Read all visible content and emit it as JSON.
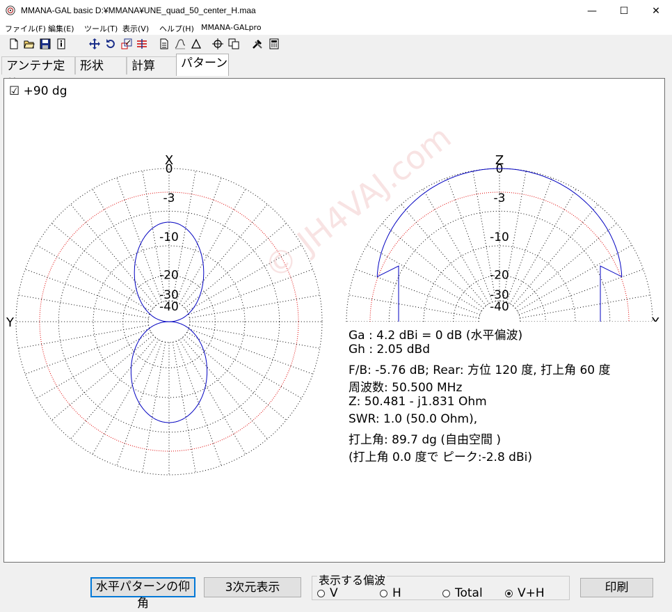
{
  "window": {
    "title": "MMANA-GAL basic  D:¥MMANA¥UNE_quad_50_center_H.maa",
    "minimize": "—",
    "maximize": "☐",
    "close": "✕"
  },
  "menu": [
    {
      "label": "ファイル(F)"
    },
    {
      "label": "編集(E)"
    },
    {
      "label": "ツール(T)"
    },
    {
      "label": "表示(V)"
    },
    {
      "label": "ヘルプ(H)"
    },
    {
      "label": "MMANA-GALpro"
    }
  ],
  "toolbar_icons": [
    "new-file-icon",
    "open-folder-icon",
    "save-icon",
    "info-icon",
    "move-icon",
    "rotate-icon",
    "scale-icon",
    "wire-edit-icon",
    "document-icon",
    "stretch-icon",
    "triangle-icon",
    "target-icon",
    "copy-icon",
    "tools-icon",
    "calculator-icon"
  ],
  "tabs": [
    {
      "label": "アンテナ定義",
      "active": false
    },
    {
      "label": "形状",
      "active": false
    },
    {
      "label": "計算",
      "active": false
    },
    {
      "label": "パターン",
      "active": true
    }
  ],
  "pattern": {
    "angle_checkbox": "☑ +90 dg",
    "left_plot": {
      "top_label": "X",
      "side_label": "Y"
    },
    "right_plot": {
      "top_label": "Z",
      "side_label": "X"
    },
    "ring_labels": [
      "0",
      "-3",
      "-10",
      "-20",
      "-30",
      "-40"
    ],
    "watermark": "© JH4VAJ.com",
    "colors": {
      "pattern": "#0000c0",
      "minus3db": "#e00000",
      "grid": "#000000"
    }
  },
  "info": [
    "Ga : 4.2 dBi = 0 dB  (水平偏波)",
    "Gh : 2.05 dBd",
    "F/B: -5.76 dB; Rear: 方位 120 度,  打上角 60 度",
    "周波数: 50.500 MHz",
    "Z: 50.481 - j1.831 Ohm",
    "SWR: 1.0 (50.0 Ohm),",
    "打上角: 89.7 dg (自由空間 )",
    "(打上角 0.0 度で ピーク:-2.8 dBi)"
  ],
  "buttons": {
    "elevation": "水平パターンの仰角",
    "view3d": "3次元表示",
    "print": "印刷"
  },
  "polarization": {
    "title": "表示する偏波",
    "options": [
      {
        "label": "V",
        "selected": false
      },
      {
        "label": "H",
        "selected": false
      },
      {
        "label": "Total",
        "selected": false
      },
      {
        "label": "V+H",
        "selected": true
      }
    ]
  }
}
